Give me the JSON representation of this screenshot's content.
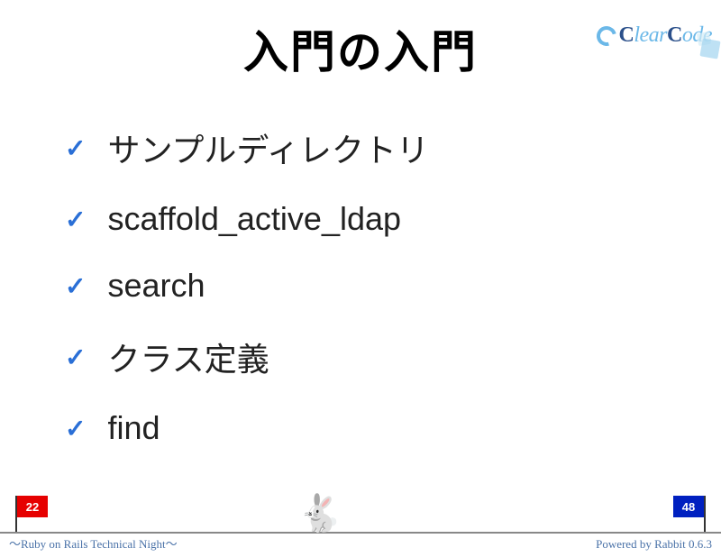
{
  "logo": {
    "text_clear": "lear",
    "text_c1": "C",
    "text_c2": "C",
    "text_ode": "ode"
  },
  "title": "入門の入門",
  "bullets": [
    "サンプルディレクトリ",
    "scaffold_active_ldap",
    "search",
    "クラス定義",
    "find"
  ],
  "progress": {
    "current": "22",
    "total": "48"
  },
  "footer": {
    "left": "〜Ruby on Rails Technical Night〜",
    "right": "Powered by Rabbit 0.6.3"
  }
}
